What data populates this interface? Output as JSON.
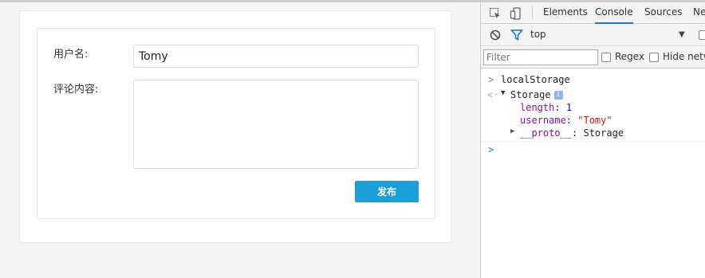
{
  "form": {
    "username_label": "用户名:",
    "username_value": "Tomy",
    "comment_label": "评论内容:",
    "comment_value": "",
    "submit_label": "发布"
  },
  "devtools": {
    "tabs": [
      "Elements",
      "Console",
      "Sources",
      "Ne"
    ],
    "active_tab": "Console",
    "context": "top",
    "filter_placeholder": "Filter",
    "regex_label": "Regex",
    "hide_network_label": "Hide netw",
    "console": {
      "command": "localStorage",
      "storage_label": "Storage",
      "info_badge": "i",
      "length_key": "length",
      "length_value": "1",
      "username_key": "username",
      "username_value": "\"Tomy\"",
      "proto_key": "__proto__",
      "proto_value": "Storage"
    }
  },
  "colors": {
    "submit_bg": "#1a9fd9",
    "active_tab_underline": "#1a73e8"
  }
}
